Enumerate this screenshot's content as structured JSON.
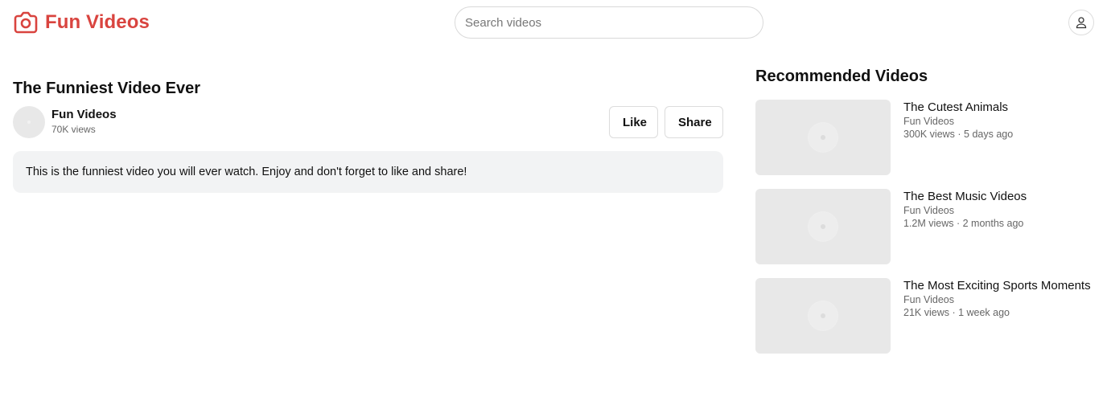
{
  "header": {
    "brand_name": "Fun Videos",
    "logo_icon": "camera-icon",
    "brand_color": "#d9443f",
    "search_placeholder": "Search videos",
    "user_icon": "user-icon"
  },
  "video": {
    "title": "The Funniest Video Ever",
    "channel": "Fun Videos",
    "views": "70K views",
    "like_label": "Like",
    "share_label": "Share",
    "description": "This is the funniest video you will ever watch. Enjoy and don't forget to like and share!"
  },
  "sidebar": {
    "heading": "Recommended Videos",
    "items": [
      {
        "title": "The Cutest Animals",
        "channel": "Fun Videos",
        "stats": "300K views · 5 days ago"
      },
      {
        "title": "The Best Music Videos",
        "channel": "Fun Videos",
        "stats": "1.2M views · 2 months ago"
      },
      {
        "title": "The Most Exciting Sports Moments",
        "channel": "Fun Videos",
        "stats": "21K views · 1 week ago"
      }
    ]
  }
}
